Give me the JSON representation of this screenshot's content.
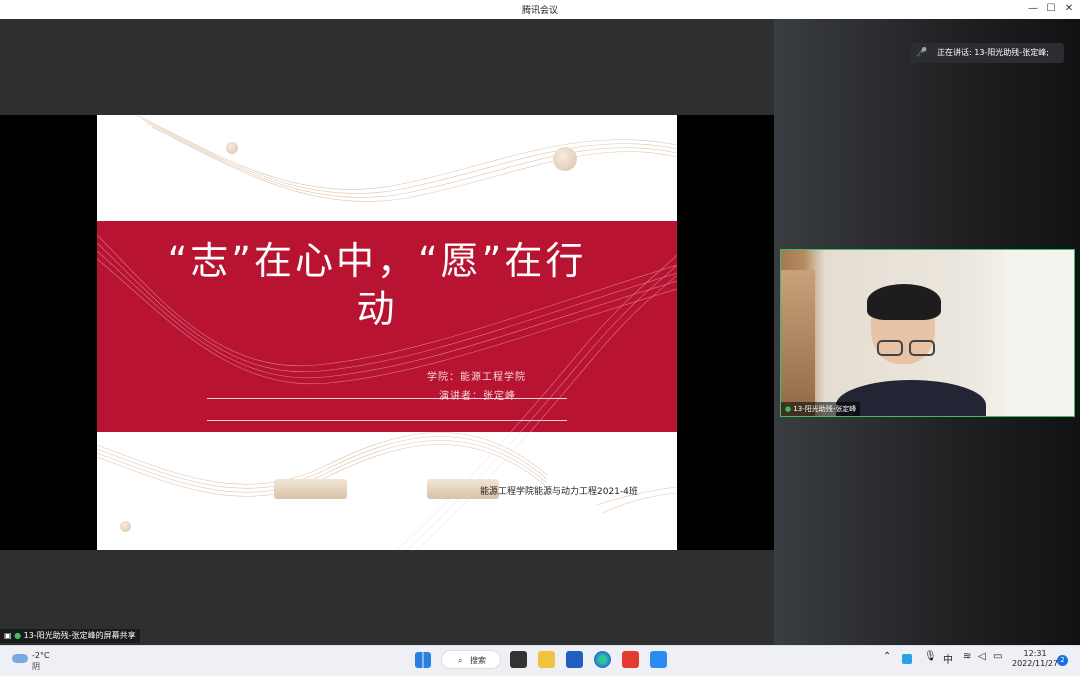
{
  "window": {
    "title": "腾讯会议",
    "minimize": "—",
    "maximize": "☐",
    "close": "✕"
  },
  "slide": {
    "title": "“志”在心中，“愿”在行动",
    "college": "学院：能源工程学院",
    "speaker": "演讲者：张定峰",
    "footer": "能源工程学院能源与动力工程2021-4班"
  },
  "speaking": {
    "text": "正在讲话: 13-阳光助残-张定峰;",
    "icon": "mic-icon"
  },
  "video": {
    "label": "13-阳光助残-张定峰"
  },
  "share": {
    "label": "13-阳光助残-张定峰的屏幕共享"
  },
  "taskbar": {
    "weather_temp": "-2°C",
    "weather_desc": "阴",
    "search_label": "搜索",
    "ime": "中",
    "time": "12:31",
    "date": "2022/11/27",
    "notifications": "2"
  },
  "colors": {
    "accent_green": "#3fbf64",
    "slide_red": "#b81330"
  }
}
